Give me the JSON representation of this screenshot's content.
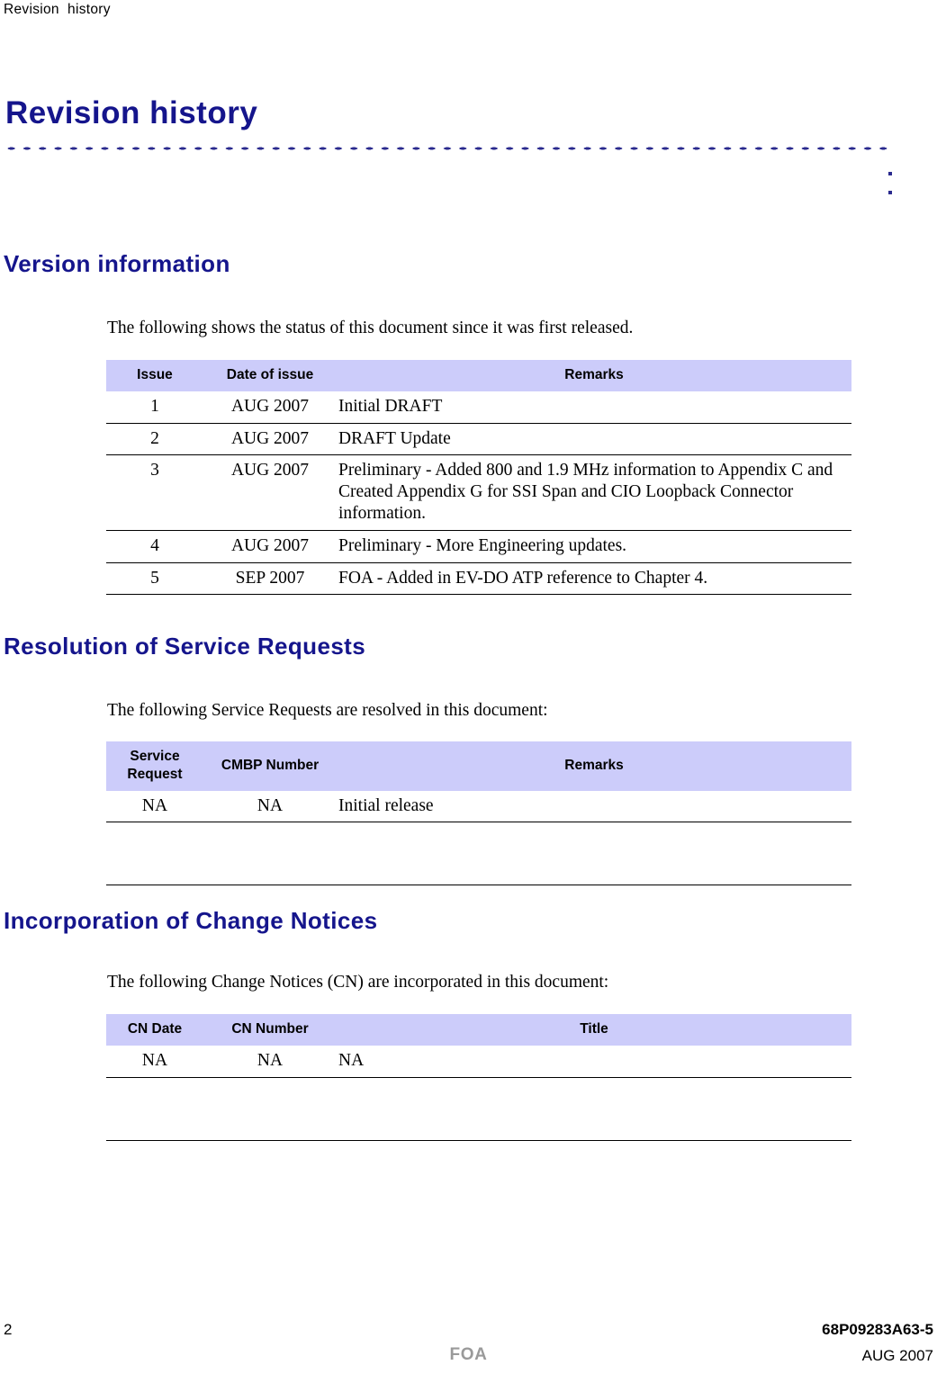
{
  "running_header": "Revision  history",
  "page_title": "Revision history",
  "colors": {
    "heading_navy": "#15158C",
    "table_header_bg": "#CCCCFA",
    "rule_dot": "#2A2A8E",
    "footer_stamp": "#9A9A9A"
  },
  "sections": {
    "version": {
      "heading": "Version information",
      "intro": "The following shows the status of this document since it was first released.",
      "table": {
        "headers": [
          "Issue",
          "Date of issue",
          "Remarks"
        ],
        "rows": [
          [
            "1",
            "AUG 2007",
            "Initial DRAFT"
          ],
          [
            "2",
            "AUG 2007",
            "DRAFT Update"
          ],
          [
            "3",
            "AUG 2007",
            "Preliminary - Added 800 and 1.9 MHz information to Appendix C and Created Appendix G for SSI Span and CIO Loopback Connector information."
          ],
          [
            "4",
            "AUG 2007",
            "Preliminary - More Engineering updates."
          ],
          [
            "5",
            "SEP 2007",
            "FOA - Added in EV-DO ATP reference to Chapter 4."
          ]
        ]
      }
    },
    "service": {
      "heading": "Resolution of Service Requests",
      "intro": "The following Service Requests are resolved in this document:",
      "table": {
        "headers": [
          "Service Request",
          "CMBP Number",
          "Remarks"
        ],
        "headers_stacked": [
          [
            "Service",
            "Request"
          ],
          [
            "CMBP Number"
          ],
          [
            "Remarks"
          ]
        ],
        "rows": [
          [
            "NA",
            "NA",
            "Initial release"
          ]
        ],
        "has_trailing_empty_row": true
      }
    },
    "change": {
      "heading": "Incorporation of Change Notices",
      "intro": "The following Change Notices (CN) are incorporated in this document:",
      "table": {
        "headers": [
          "CN Date",
          "CN Number",
          "Title"
        ],
        "rows": [
          [
            "NA",
            "NA",
            "NA"
          ]
        ],
        "has_trailing_empty_row": true
      }
    }
  },
  "footer": {
    "page_number": "2",
    "document_number": "68P09283A63-5",
    "stamp": "FOA",
    "date": "AUG 2007"
  }
}
